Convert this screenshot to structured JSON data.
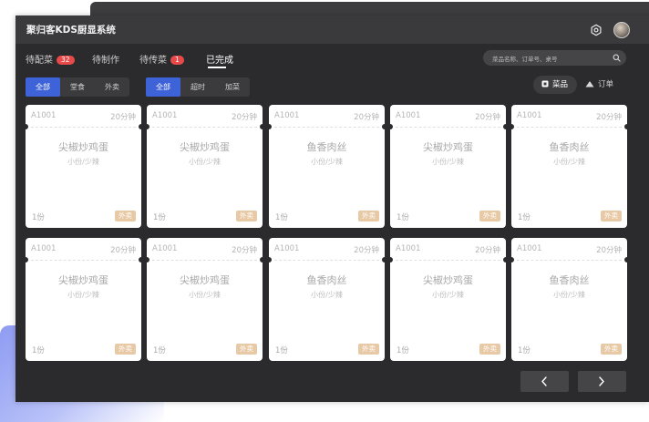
{
  "app": {
    "title": "聚归客KDS厨显系统"
  },
  "header": {
    "settings_icon": "gear-icon",
    "avatar_icon": "avatar"
  },
  "tabs": [
    {
      "label": "待配菜",
      "badge": "32"
    },
    {
      "label": "待制作"
    },
    {
      "label": "待传菜",
      "badge": "1"
    },
    {
      "label": "已完成",
      "active": true
    }
  ],
  "search": {
    "placeholder": "菜品名称、订单号、桌号",
    "icon": "search-icon"
  },
  "filter_channel": {
    "options": [
      "全部",
      "堂食",
      "外卖"
    ],
    "selected": "全部"
  },
  "filter_status": {
    "options": [
      "全部",
      "超时",
      "加菜"
    ],
    "selected": "全部"
  },
  "view_toggle": {
    "options": [
      {
        "label": "菜品",
        "icon": "dish-icon"
      },
      {
        "label": "订单",
        "icon": "order-icon"
      }
    ],
    "selected": "菜品"
  },
  "cards": [
    {
      "order_no": "A1001",
      "time": "20分钟",
      "dish": "尖椒炒鸡蛋",
      "spec": "小份/少辣",
      "qty": "1份",
      "type": "外卖"
    },
    {
      "order_no": "A1001",
      "time": "20分钟",
      "dish": "尖椒炒鸡蛋",
      "spec": "小份/少辣",
      "qty": "1份",
      "type": "外卖"
    },
    {
      "order_no": "A1001",
      "time": "20分钟",
      "dish": "鱼香肉丝",
      "spec": "小份/少辣",
      "qty": "1份",
      "type": "外卖"
    },
    {
      "order_no": "A1001",
      "time": "20分钟",
      "dish": "尖椒炒鸡蛋",
      "spec": "小份/少辣",
      "qty": "1份",
      "type": "外卖"
    },
    {
      "order_no": "A1001",
      "time": "20分钟",
      "dish": "鱼香肉丝",
      "spec": "小份/少辣",
      "qty": "1份",
      "type": "外卖"
    },
    {
      "order_no": "A1001",
      "time": "20分钟",
      "dish": "尖椒炒鸡蛋",
      "spec": "小份/少辣",
      "qty": "1份",
      "type": "外卖"
    },
    {
      "order_no": "A1001",
      "time": "20分钟",
      "dish": "尖椒炒鸡蛋",
      "spec": "小份/少辣",
      "qty": "1份",
      "type": "外卖"
    },
    {
      "order_no": "A1001",
      "time": "20分钟",
      "dish": "鱼香肉丝",
      "spec": "小份/少辣",
      "qty": "1份",
      "type": "外卖"
    },
    {
      "order_no": "A1001",
      "time": "20分钟",
      "dish": "尖椒炒鸡蛋",
      "spec": "小份/少辣",
      "qty": "1份",
      "type": "外卖"
    },
    {
      "order_no": "A1001",
      "time": "20分钟",
      "dish": "鱼香肉丝",
      "spec": "小份/少辣",
      "qty": "1份",
      "type": "外卖"
    }
  ],
  "pagination": {
    "prev_icon": "chevron-left-icon",
    "next_icon": "chevron-right-icon"
  },
  "colors": {
    "accent": "#3e63d8",
    "badge": "#e84a4a",
    "tag": "#e8c9a6",
    "window_bg": "#2b2b2d"
  }
}
